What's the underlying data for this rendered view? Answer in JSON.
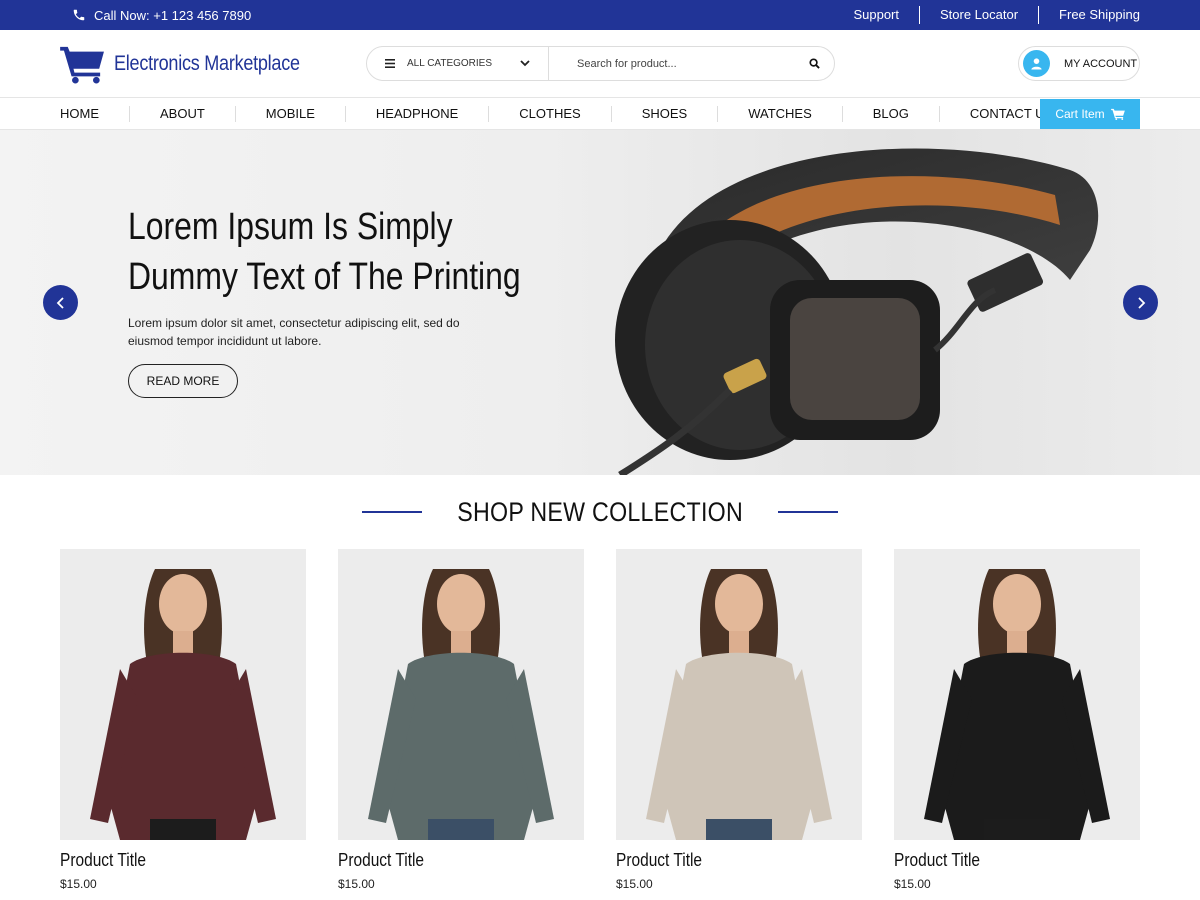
{
  "topbar": {
    "call": "Call Now: +1 123 456 7890",
    "links": [
      "Support",
      "Store Locator",
      "Free Shipping"
    ]
  },
  "header": {
    "brand": "Electronics Marketplace",
    "category_label": "ALL CATEGORIES",
    "search_placeholder": "Search for product...",
    "account_label": "MY ACCOUNT"
  },
  "nav": {
    "items": [
      "HOME",
      "ABOUT",
      "MOBILE",
      "HEADPHONE",
      "CLOTHES",
      "SHOES",
      "WATCHES",
      "BLOG",
      "CONTACT US"
    ],
    "cart_label": "Cart Item"
  },
  "hero": {
    "title_line1": "Lorem Ipsum Is Simply",
    "title_line2": "Dummy Text of The Printing",
    "description": "Lorem ipsum dolor sit amet, consectetur adipiscing elit, sed do eiusmod tempor incididunt ut labore.",
    "button": "READ MORE"
  },
  "collection": {
    "title": "SHOP NEW COLLECTION",
    "products": [
      {
        "title": "Product Title",
        "price": "$15.00",
        "color": "#5a2a2e"
      },
      {
        "title": "Product Title",
        "price": "$15.00",
        "color": "#5d6b6a"
      },
      {
        "title": "Product Title",
        "price": "$15.00",
        "color": "#cfc5b8"
      },
      {
        "title": "Product Title",
        "price": "$15.00",
        "color": "#1b1b1b"
      }
    ]
  },
  "colors": {
    "primary": "#213497",
    "accent": "#38b6ef"
  },
  "icons": {
    "phone": "phone-icon",
    "cart_logo": "shopping-cart-icon",
    "menu": "menu-icon",
    "search": "search-icon",
    "user": "user-icon",
    "prev": "chevron-left-icon",
    "next": "chevron-right-icon"
  }
}
